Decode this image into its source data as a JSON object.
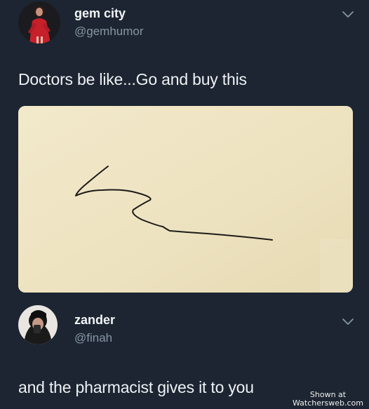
{
  "tweet1": {
    "display_name": "gem city",
    "handle": "@gemhumor",
    "text": "Doctors be like...Go and buy this",
    "avatar_icon": "avatar-photo-red-outfit",
    "menu_icon": "chevron-down-icon",
    "media": {
      "description_icon": "handwritten-scribble-note",
      "paper_color": "#efe5c4"
    }
  },
  "tweet2": {
    "display_name": "zander",
    "handle": "@finah",
    "text": "and the pharmacist gives it to you",
    "avatar_icon": "avatar-photo-dark",
    "menu_icon": "chevron-down-icon"
  },
  "watermark": {
    "line1": "Shown at",
    "line2": "Watchersweb.com"
  },
  "colors": {
    "background": "#1c2531",
    "handle": "#8796a5",
    "text": "#eef1f4"
  }
}
